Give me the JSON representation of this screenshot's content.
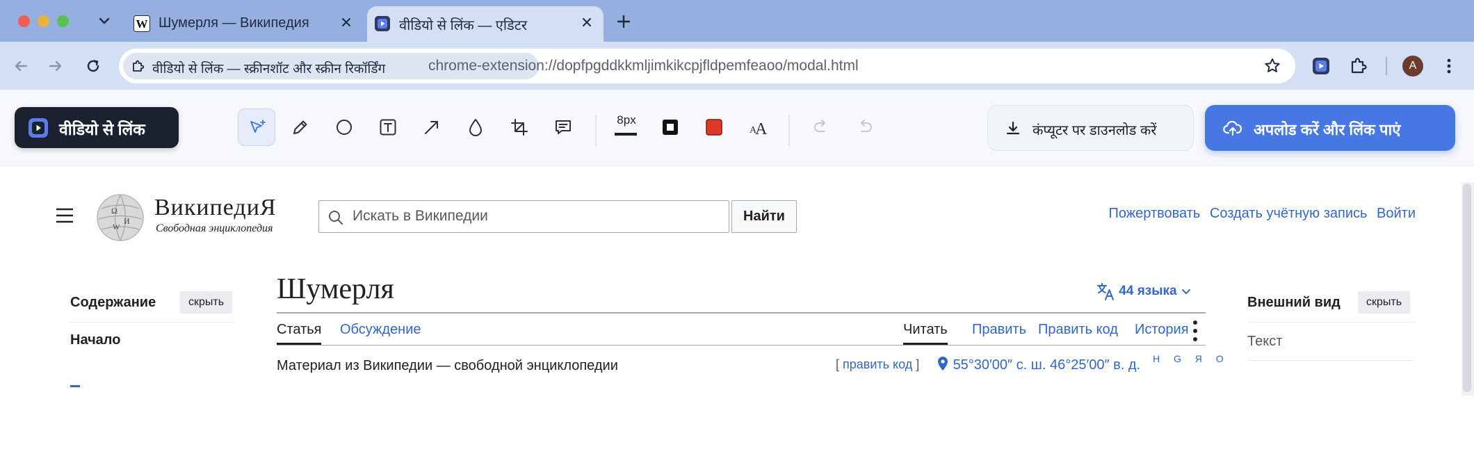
{
  "browser": {
    "tabs": [
      {
        "title": "Шумерля — Википедия",
        "favicon": "wikipedia-w-icon",
        "active": false
      },
      {
        "title": "वीडियो से लिंक — एडिटर",
        "favicon": "extension-play-icon",
        "active": true
      }
    ],
    "site_chip": "वीडियो से लिंक — स्क्रीनशॉट और स्क्रीन रिकॉर्डिंग",
    "url": "chrome-extension://dopfpgddkkmljimkikcpjfldpemfeaoo/modal.html",
    "profile_initial": "A",
    "colors": {
      "tabstrip": "#95b0e0",
      "toolbar": "#d3dff3"
    }
  },
  "editor": {
    "brand_label": "वीडियो से लिंक",
    "tools": [
      "select-tool",
      "pencil-tool",
      "ellipse-tool",
      "text-tool",
      "arrow-tool",
      "blur-tool",
      "crop-tool",
      "comment-tool"
    ],
    "stroke_size": "8px",
    "stroke_color": "#111111",
    "fill_color": "#e0392b",
    "download_label": "कंप्यूटर पर डाउनलोड करें",
    "upload_label": "अपलोड करें और लिंक पाएं",
    "accent_color": "#4677e3"
  },
  "wiki": {
    "wordmark": "ВикипедиЯ",
    "tagline_logo": "Свободная энциклопедия",
    "search_placeholder": "Искать в Википедии",
    "search_button": "Найти",
    "top_links": [
      "Пожертвовать",
      "Создать учётную запись",
      "Войти"
    ],
    "toc": {
      "title": "Содержание",
      "hide": "скрыть",
      "first_item": "Начало"
    },
    "article_title": "Шумерля",
    "languages": "44 языка",
    "namespace_tabs": [
      "Статья",
      "Обсуждение"
    ],
    "view_tabs": [
      "Читать",
      "Править",
      "Править код",
      "История"
    ],
    "from_wikipedia": "Материал из Википедии — свободной энциклопедии",
    "edit_code_link": "править код",
    "coordinates": "55°30′00″ с. ш. 46°25′00″ в. д.",
    "map_links": "H G Я O",
    "appearance": {
      "title": "Внешний вид",
      "hide": "скрыть",
      "first_item": "Текст"
    }
  }
}
